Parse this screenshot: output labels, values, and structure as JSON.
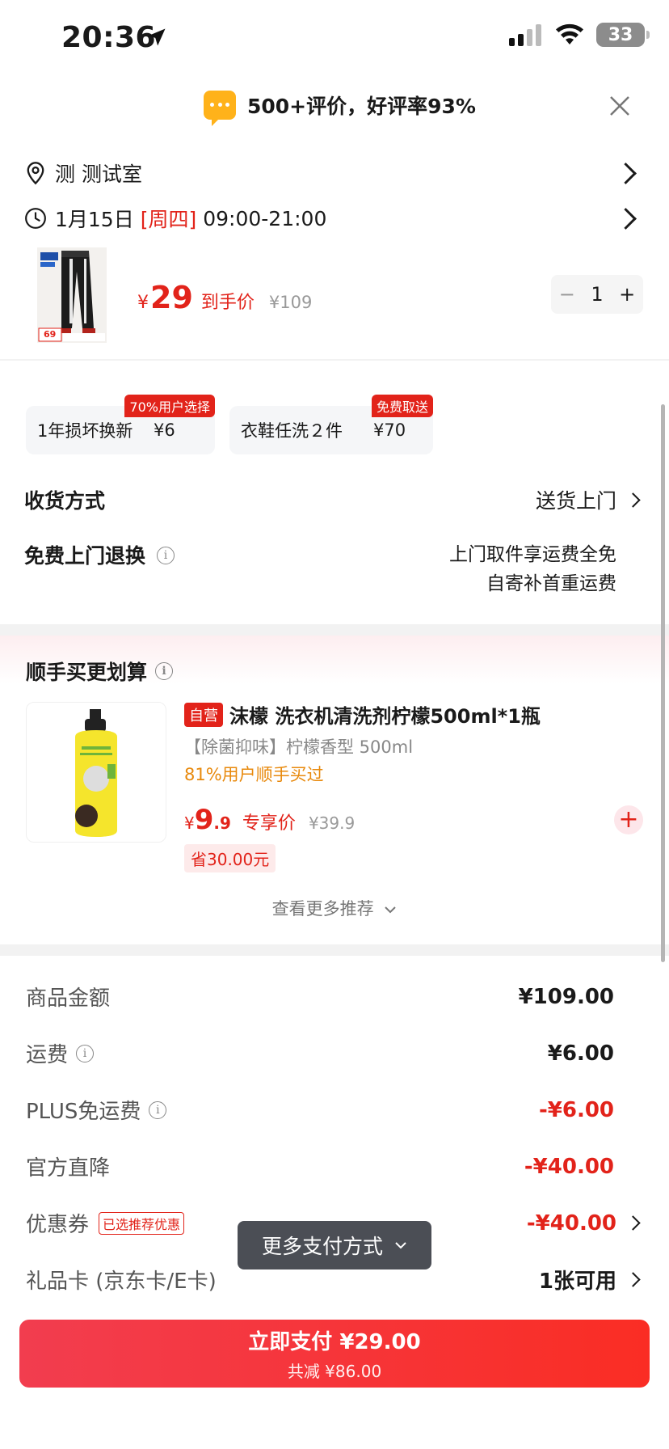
{
  "status_bar": {
    "time": "20:36",
    "battery": "33"
  },
  "toast": {
    "text": "500+评价，好评率93%"
  },
  "address": {
    "label": "测 测试室"
  },
  "delivery_time": {
    "date": "1月15日",
    "weekday": "[周四]",
    "hours": "09:00-21:00"
  },
  "product": {
    "price_symbol": "¥",
    "price": "29",
    "price_label": "到手价",
    "original_price": "¥109",
    "quantity": "1",
    "image_badge": "69"
  },
  "services": [
    {
      "name": "1年损坏换新",
      "price": "¥6",
      "tag": "70%用户选择"
    },
    {
      "name": "衣鞋任洗２件",
      "price": "¥70",
      "tag": "免费取送"
    }
  ],
  "shipping": {
    "label": "收货方式",
    "value": "送货上门"
  },
  "return_service": {
    "label": "免费上门退换",
    "line1": "上门取件享运费全免",
    "line2": "自寄补首重运费"
  },
  "recommend": {
    "title": "顺手买更划算",
    "item": {
      "tag": "自营",
      "name": "沫檬 洗衣机清洗剂柠檬500ml*1瓶",
      "spec": "【除菌抑味】柠檬香型 500ml",
      "hint": "81%用户顺手买过",
      "price_symbol": "¥",
      "price_int": "9",
      "price_dec": ".9",
      "price_label": "专享价",
      "original_price": "¥39.9",
      "save": "省30.00元"
    },
    "more": "查看更多推荐"
  },
  "summary": [
    {
      "label": "商品金额",
      "value": "¥109.00"
    },
    {
      "label": "运费",
      "value": "¥6.00"
    },
    {
      "label": "PLUS免运费",
      "value": "-¥6.00"
    },
    {
      "label": "官方直降",
      "value": "-¥40.00"
    },
    {
      "label": "优惠券",
      "tag": "已选推荐优惠",
      "value": "-¥40.00"
    },
    {
      "label": "礼品卡 (京东卡/E卡)",
      "value": "1张可用"
    }
  ],
  "pay_more": "更多支付方式",
  "pay_button": {
    "label": "立即支付 ¥29.00",
    "sub": "共减 ¥86.00"
  }
}
